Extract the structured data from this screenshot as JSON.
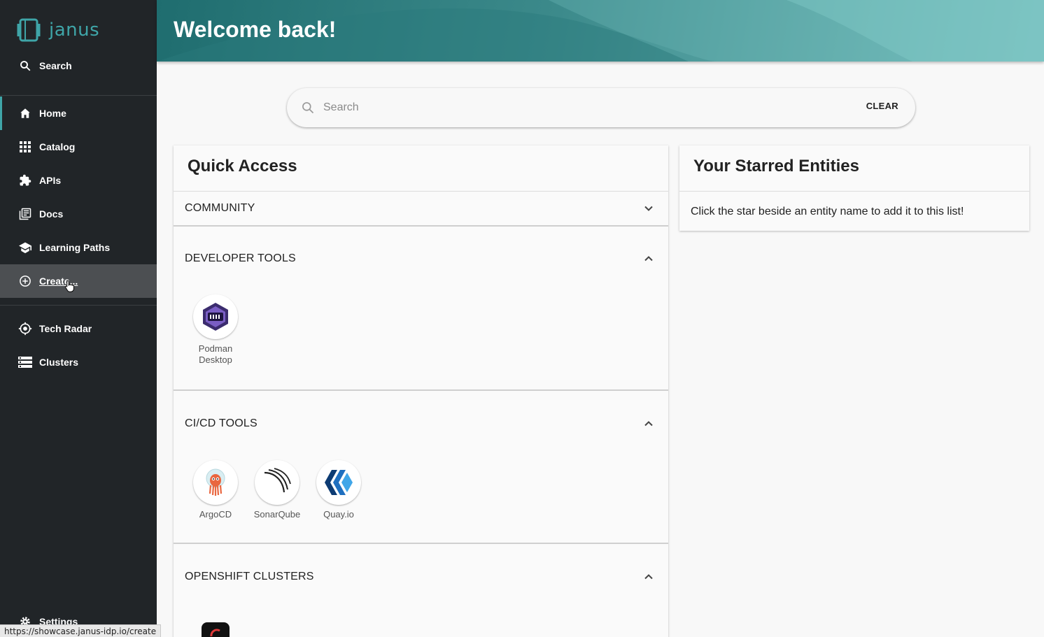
{
  "sidebar": {
    "logo_text": "janus",
    "search_label": "Search",
    "items": [
      {
        "label": "Home",
        "icon": "home-icon"
      },
      {
        "label": "Catalog",
        "icon": "grid-icon"
      },
      {
        "label": "APIs",
        "icon": "puzzle-icon"
      },
      {
        "label": "Docs",
        "icon": "library-icon"
      },
      {
        "label": "Learning Paths",
        "icon": "school-icon"
      },
      {
        "label": "Create...",
        "icon": "add-circle-icon"
      },
      {
        "label": "Tech Radar",
        "icon": "radar-icon"
      },
      {
        "label": "Clusters",
        "icon": "storage-icon"
      }
    ],
    "settings_label": "Settings",
    "accent": "#3fa5a8"
  },
  "status_url": "https://showcase.janus-idp.io/create",
  "header": {
    "title": "Welcome back!"
  },
  "search": {
    "placeholder": "Search",
    "clear_label": "CLEAR"
  },
  "quick_access": {
    "title": "Quick Access",
    "sections": [
      {
        "title": "COMMUNITY",
        "expanded": false,
        "tools": []
      },
      {
        "title": "DEVELOPER TOOLS",
        "expanded": true,
        "tools": [
          {
            "name": "Podman Desktop"
          }
        ]
      },
      {
        "title": "CI/CD TOOLS",
        "expanded": true,
        "tools": [
          {
            "name": "ArgoCD"
          },
          {
            "name": "SonarQube"
          },
          {
            "name": "Quay.io"
          }
        ]
      },
      {
        "title": "OPENSHIFT CLUSTERS",
        "expanded": true,
        "tools": []
      }
    ]
  },
  "starred": {
    "title": "Your Starred Entities",
    "message": "Click the star beside an entity name to add it to this list!"
  }
}
